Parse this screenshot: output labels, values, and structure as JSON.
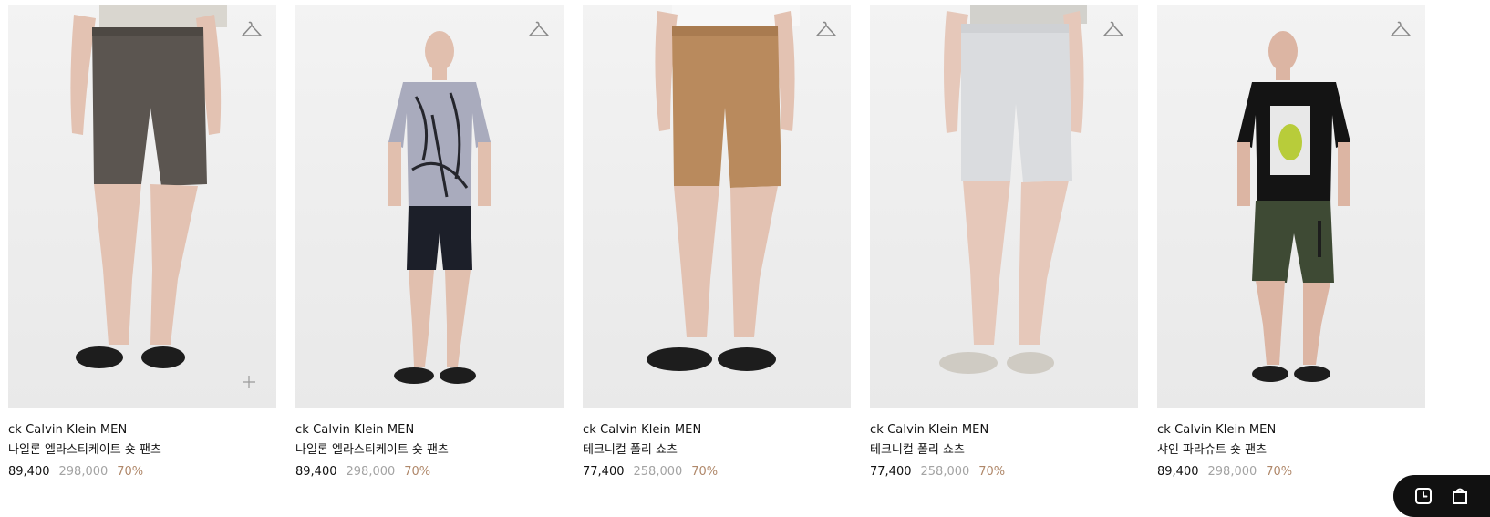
{
  "products": [
    {
      "brand": "ck Calvin Klein MEN",
      "name": "나일론 엘라스티케이트 숏 팬츠",
      "price": "89,400",
      "original_price": "298,000",
      "discount": "70%",
      "icons": {
        "wishlist": "hanger-icon",
        "quick_add": "plus-icon"
      },
      "colors": {
        "shorts": "#5b5550",
        "top": "#d9d6cf",
        "sandals": "#1d1d1d",
        "skin": "#e3c2b2"
      }
    },
    {
      "brand": "ck Calvin Klein MEN",
      "name": "나일론 엘라스티케이트 숏 팬츠",
      "price": "89,400",
      "original_price": "298,000",
      "discount": "70%",
      "icons": {
        "wishlist": "hanger-icon"
      },
      "colors": {
        "shorts": "#1c1f29",
        "top": "#a9abbd",
        "sandals": "#1d1d1d",
        "skin": "#e1bfae"
      }
    },
    {
      "brand": "ck Calvin Klein MEN",
      "name": "테크니컬 폴리 쇼츠",
      "price": "77,400",
      "original_price": "258,000",
      "discount": "70%",
      "icons": {
        "wishlist": "hanger-icon"
      },
      "colors": {
        "shorts": "#b98a5d",
        "top": "#f7f7f7",
        "sandals": "#1d1d1d",
        "skin": "#e3c2b2"
      }
    },
    {
      "brand": "ck Calvin Klein MEN",
      "name": "테크니컬 폴리 쇼츠",
      "price": "77,400",
      "original_price": "258,000",
      "discount": "70%",
      "icons": {
        "wishlist": "hanger-icon"
      },
      "colors": {
        "shorts": "#dadcdf",
        "top": "#d2d1cc",
        "sandals": "#cfcbc3",
        "skin": "#e6c8ba"
      }
    },
    {
      "brand": "ck Calvin Klein MEN",
      "name": "샤인 파라슈트 숏 팬츠",
      "price": "89,400",
      "original_price": "298,000",
      "discount": "70%",
      "icons": {
        "wishlist": "hanger-icon"
      },
      "colors": {
        "shorts": "#3e4a34",
        "top": "#141414",
        "sandals": "#1d1d1d",
        "skin": "#dcb5a3"
      }
    }
  ],
  "floating_actions": {
    "icons": [
      "clock-icon",
      "store-icon"
    ],
    "background": "#111111"
  }
}
